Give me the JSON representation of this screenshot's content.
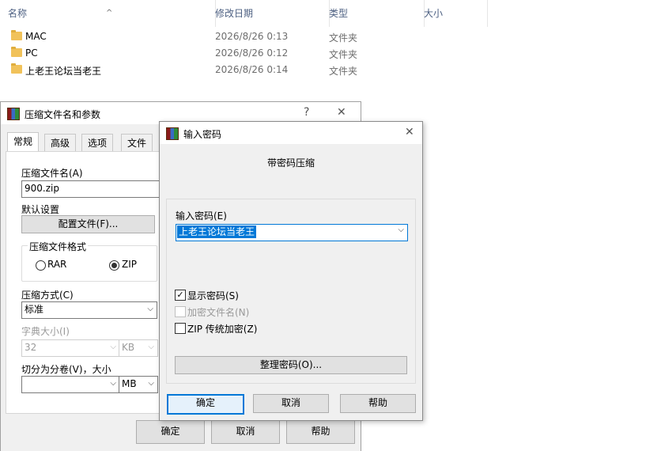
{
  "explorer": {
    "columns": {
      "name": "名称",
      "date": "修改日期",
      "type": "类型",
      "size": "大小"
    },
    "sort_indicator": "^",
    "files": [
      {
        "name": "MAC",
        "date": "2026/8/26 0:13",
        "type": "文件夹"
      },
      {
        "name": "PC",
        "date": "2026/8/26 0:12",
        "type": "文件夹"
      },
      {
        "name": "上老王论坛当老王",
        "date": "2026/8/26 0:14",
        "type": "文件夹"
      }
    ]
  },
  "archive_dialog": {
    "title": "压缩文件名和参数",
    "help_glyph": "?",
    "close_glyph": "✕",
    "tabs": [
      "常规",
      "高级",
      "选项",
      "文件"
    ],
    "archive_name_label": "压缩文件名(A)",
    "archive_name_value": "900.zip",
    "default_settings_label": "默认设置",
    "profiles_button": "配置文件(F)...",
    "format_group_label": "压缩文件格式",
    "format_rar": "RAR",
    "format_zip": "ZIP",
    "method_label": "压缩方式(C)",
    "method_value": "标准",
    "dict_size_label": "字典大小(I)",
    "dict_size_value": "32",
    "dict_unit": "KB",
    "split_label": "切分为分卷(V)，大小",
    "split_value": "",
    "split_unit": "MB",
    "ok": "确定",
    "cancel": "取消",
    "help": "帮助"
  },
  "password_dialog": {
    "title": "输入密码",
    "close_glyph": "✕",
    "heading": "带密码压缩",
    "password_label": "输入密码(E)",
    "password_value": "上老王论坛当老王",
    "show_password": "显示密码(S)",
    "show_password_checked": true,
    "encrypt_names": "加密文件名(N)",
    "zip_legacy": "ZIP 传统加密(Z)",
    "organize_button": "整理密码(O)...",
    "ok": "确定",
    "cancel": "取消",
    "help": "帮助"
  },
  "icons": {
    "dropdown": "⌵",
    "check": "✓"
  }
}
